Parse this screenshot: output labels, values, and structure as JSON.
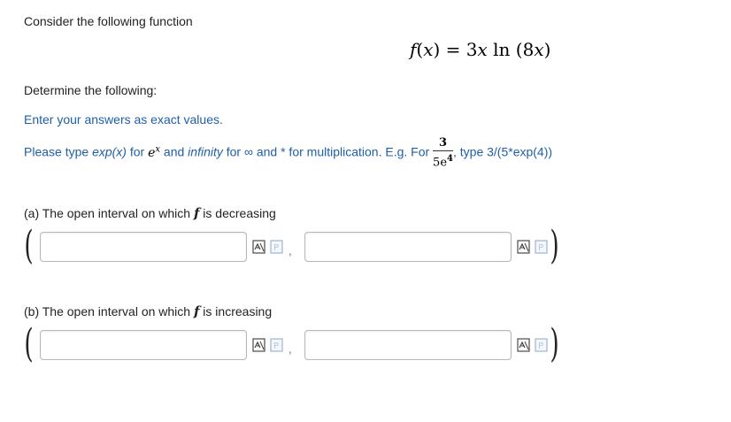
{
  "intro": "Consider the following function",
  "formula": {
    "lhs": "f",
    "var": "x",
    "eq": "= 3",
    "ln": "ln",
    "inner": "(8",
    "close": ")"
  },
  "determine": "Determine the following:",
  "exact_note": "Enter your answers as exact values.",
  "instructions": {
    "p1": "Please type ",
    "exp": "exp(x)",
    "p2": " for ",
    "e": "e",
    "x": "x",
    "p3": " and ",
    "infinity": "infinity",
    "p4": " for ∞ and * for multiplication.  E.g.  For ",
    "frac_num": "3",
    "frac_den": "5e",
    "frac_den_exp": "4",
    "p5": ", type 3/(5*exp(4))"
  },
  "part_a": {
    "prefix": "(a) The open interval on which ",
    "f": "f",
    "suffix": " is decreasing",
    "left_value": "",
    "right_value": ""
  },
  "part_b": {
    "prefix": "(b) The open interval on which ",
    "f": "f",
    "suffix": " is increasing",
    "left_value": "",
    "right_value": ""
  },
  "punct": {
    "open": "(",
    "close": ")",
    "comma": ","
  },
  "icons": {
    "editor": "equation-editor-icon",
    "preview": "preview-icon"
  }
}
